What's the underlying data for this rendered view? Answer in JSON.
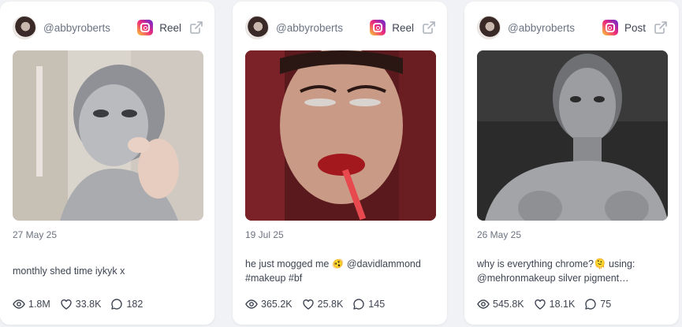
{
  "posts": [
    {
      "handle": "@abbyroberts",
      "type": "Reel",
      "date": "27 May 25",
      "caption": "monthly shed time iykyk x",
      "views": "1.8M",
      "likes": "33.8K",
      "comments": "182"
    },
    {
      "handle": "@abbyroberts",
      "type": "Reel",
      "date": "19 Jul 25",
      "caption": "he just mogged me 🫨 @davidlammond #makeup #bf",
      "views": "365.2K",
      "likes": "25.8K",
      "comments": "145"
    },
    {
      "handle": "@abbyroberts",
      "type": "Post",
      "date": "26 May 25",
      "caption": "why is everything chrome?🫠 using: @mehronmakeup silver pigment…",
      "views": "545.8K",
      "likes": "18.1K",
      "comments": "75"
    }
  ],
  "colors": {
    "instagram_gradient": [
      "#f9ce34",
      "#ee2a7b",
      "#6228d7"
    ]
  },
  "icons": [
    "instagram-icon",
    "external-link-icon",
    "eye-icon",
    "heart-icon",
    "comment-icon"
  ]
}
